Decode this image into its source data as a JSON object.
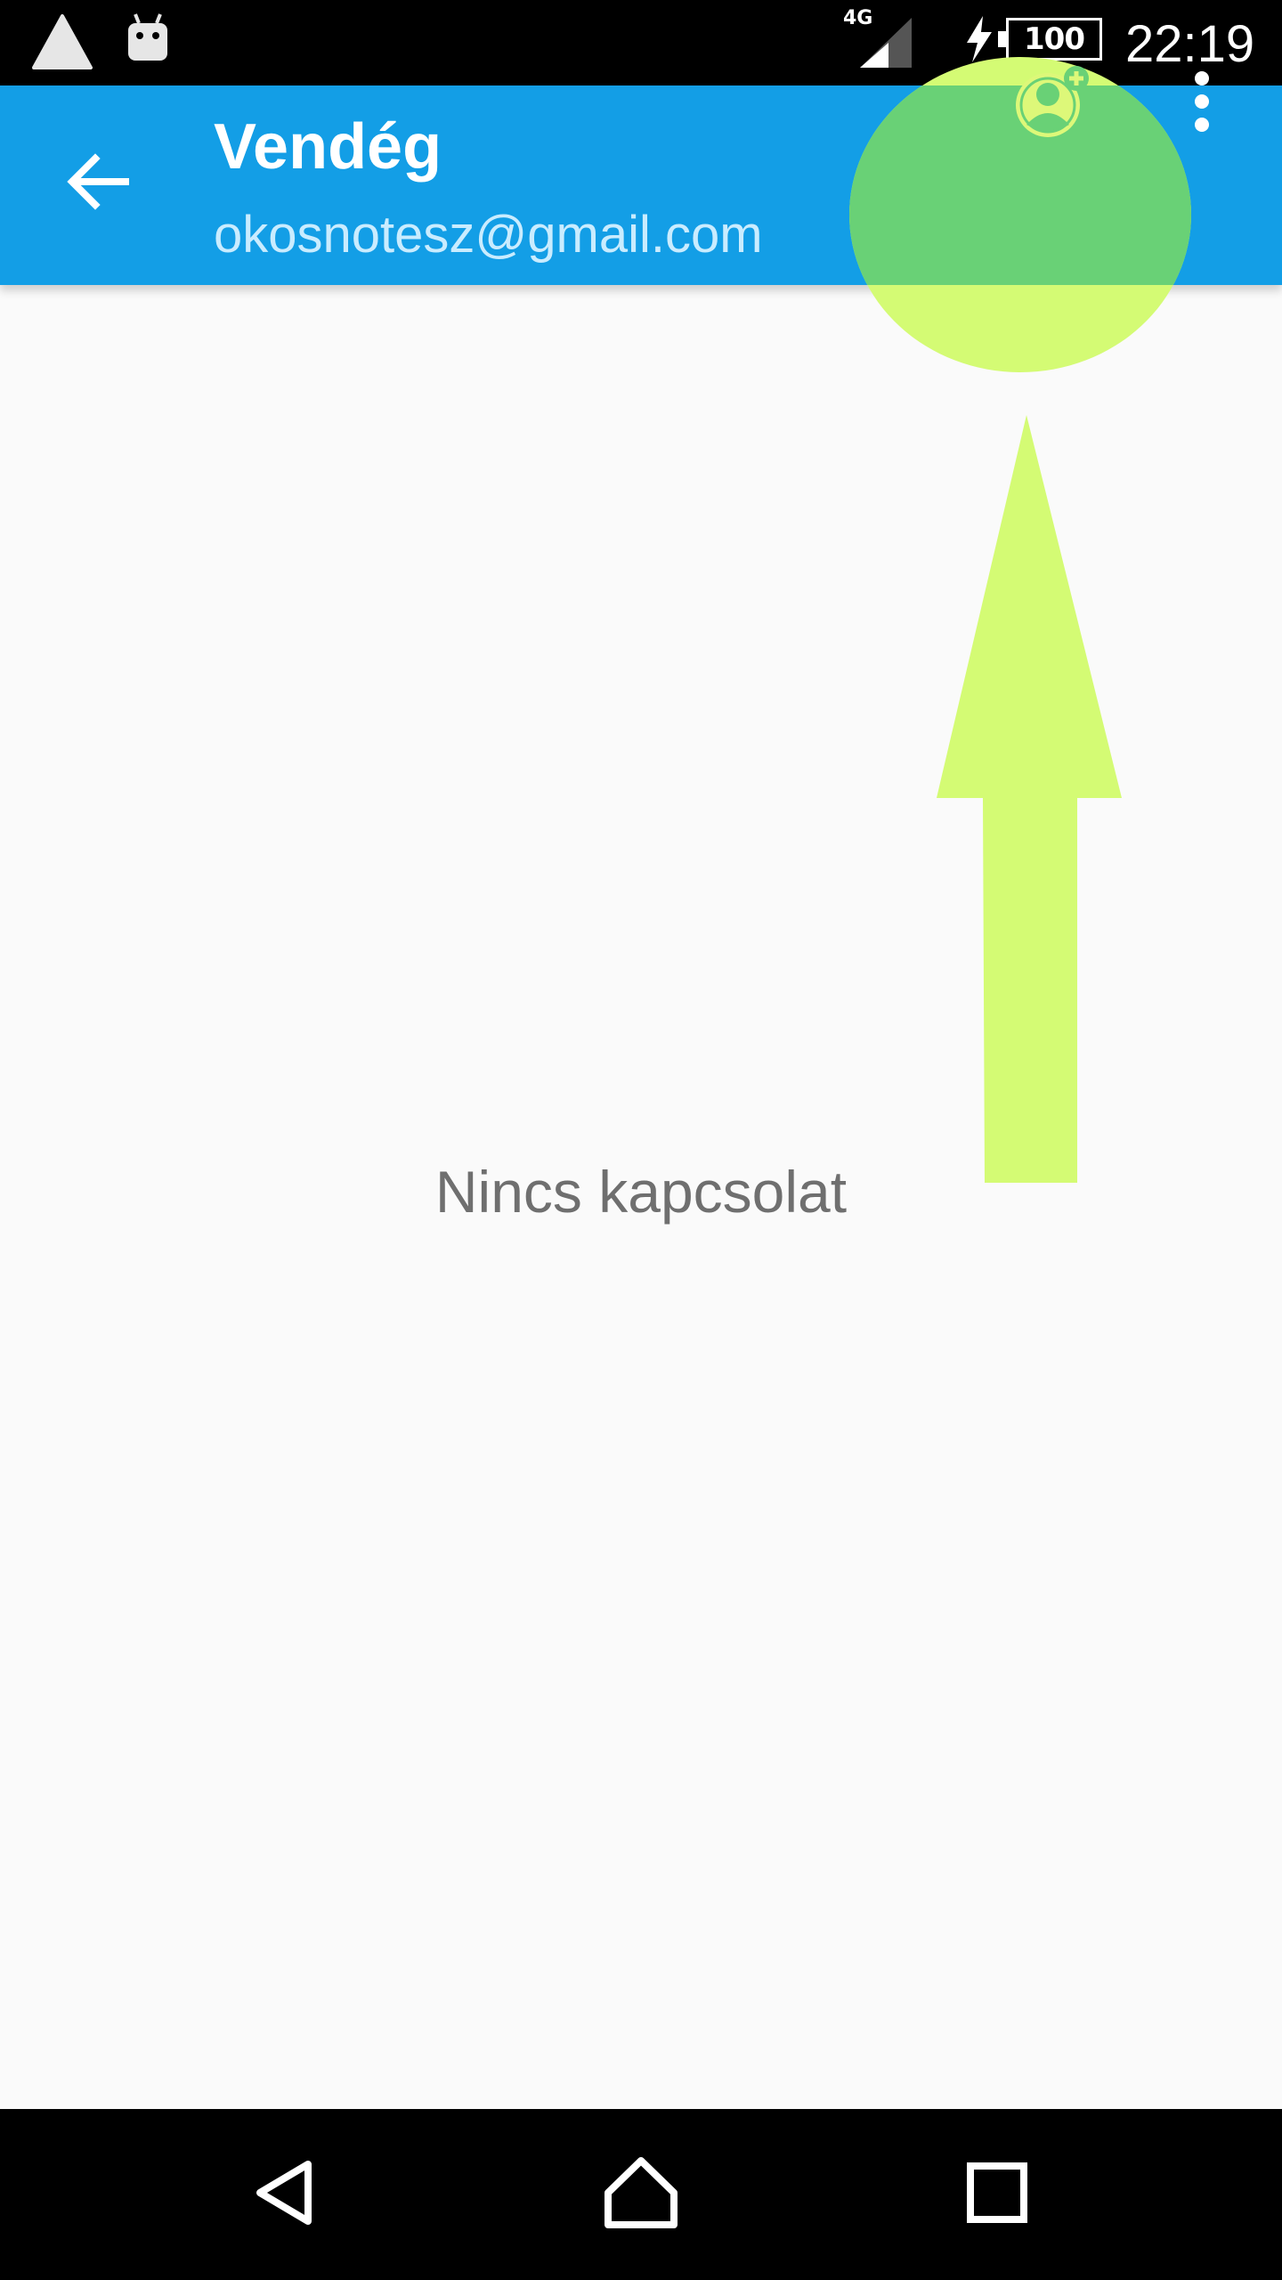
{
  "status_bar": {
    "network_type": "4G",
    "battery_level": "100",
    "time": "22:19",
    "icons": [
      "warning-icon",
      "android-debug-icon",
      "signal-icon",
      "charging-bolt-icon",
      "battery-icon"
    ]
  },
  "app_bar": {
    "title": "Vendég",
    "subtitle": "okosnotesz@gmail.com",
    "icons": [
      "back-arrow-icon",
      "add-contact-icon",
      "overflow-menu-icon"
    ]
  },
  "content": {
    "empty_message": "Nincs kapcsolat"
  },
  "annotation": {
    "highlight_color": "#d4fb74",
    "highlight_target": "add-contact-button"
  },
  "nav_bar": {
    "icons": [
      "nav-back-icon",
      "nav-home-icon",
      "nav-recent-icon"
    ]
  },
  "colors": {
    "app_bar": "#139ee6",
    "background": "#fafafa",
    "empty_text": "#6f6f6f"
  }
}
